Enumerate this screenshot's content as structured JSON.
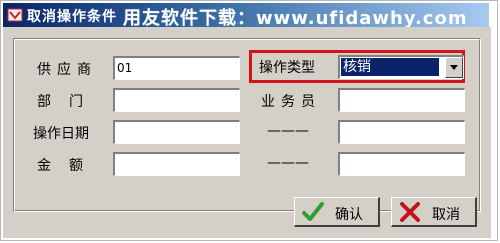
{
  "window": {
    "title": "取消操作条件",
    "watermark": "用友软件下载：www.ufidawhy.com"
  },
  "form": {
    "supplier_label": "供应商",
    "supplier_value": "01",
    "department_label": "部　门",
    "department_value": "",
    "op_date_label": "操作日期",
    "op_date_value": "",
    "amount_label": "金　额",
    "amount_value": "",
    "op_type_label": "操作类型",
    "op_type_value": "核销",
    "clerk_label": "业务员",
    "clerk_value": "",
    "dash1_label": "———",
    "dash1_value": "",
    "dash2_label": "———",
    "dash2_value": ""
  },
  "buttons": {
    "ok_label": "确认",
    "cancel_label": "取消"
  },
  "colors": {
    "title_bar_start": "#0a246a",
    "title_bar_end": "#a6caf0",
    "dialog_face": "#d4d0c8",
    "highlight_border": "#d2141a",
    "selection_bg": "#0a246a",
    "ok_icon": "#2e9e2e",
    "cancel_icon": "#c0141a"
  },
  "icons": {
    "app": "app-icon",
    "combo_arrow": "chevron-down-icon",
    "ok": "checkmark-icon",
    "cancel": "close-icon"
  }
}
